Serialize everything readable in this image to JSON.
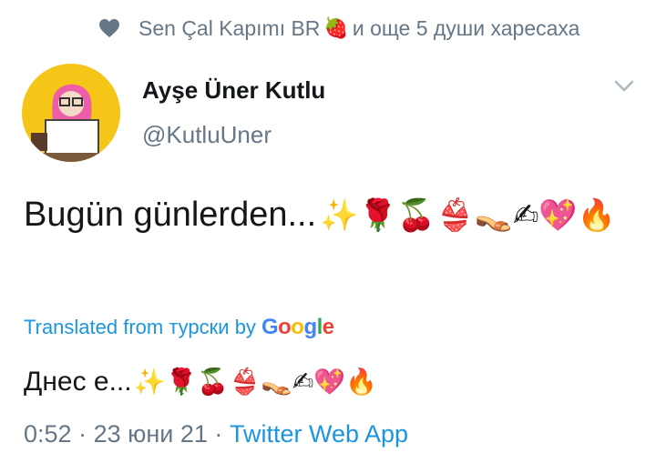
{
  "social_context": {
    "name": "Sen Çal Kapımı BR",
    "flag_emoji": "🍓",
    "suffix": "и още 5 души харесаха"
  },
  "author": {
    "display_name": "Ayşe Üner Kutlu",
    "handle": "@KutluUner"
  },
  "tweet": {
    "text": "Bugün günlerden...",
    "emojis": "✨🌹🍒👙👡✍💖🔥"
  },
  "translation": {
    "label": "Translated from турски by",
    "provider": "Google",
    "text": "Днес е...",
    "emojis": "✨🌹🍒👙👡✍💖🔥"
  },
  "meta": {
    "time": "0:52",
    "sep1": "·",
    "date": "23 юни 21",
    "sep2": "·",
    "app": "Twitter Web App"
  },
  "colors": {
    "link": "#1b95e0",
    "secondary": "#657786",
    "avatar_bg": "#f5c518"
  },
  "icons": {
    "like": "heart-icon",
    "menu": "chevron-down-icon"
  }
}
